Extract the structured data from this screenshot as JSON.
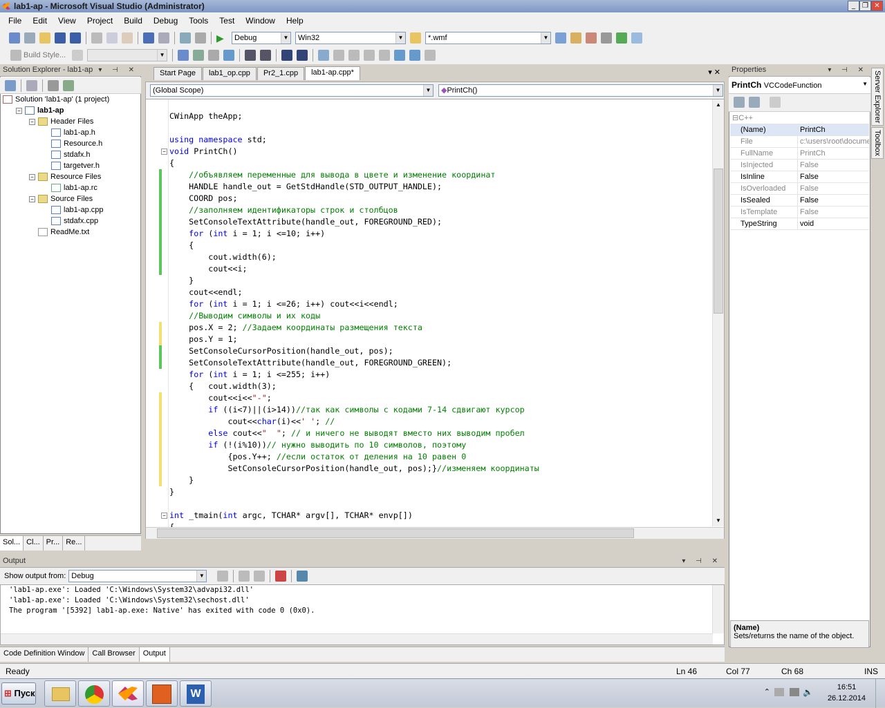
{
  "window": {
    "title": "lab1-ap - Microsoft Visual Studio (Administrator)",
    "minimize": "_",
    "maximize": "❐",
    "close": "✕"
  },
  "menu": [
    "File",
    "Edit",
    "View",
    "Project",
    "Build",
    "Debug",
    "Tools",
    "Test",
    "Window",
    "Help"
  ],
  "toolbar": {
    "config": "Debug",
    "platform": "Win32",
    "find": "*.wmf",
    "build_style": "Build Style..."
  },
  "solution_explorer": {
    "title": "Solution Explorer - lab1-ap",
    "tree": [
      {
        "label": "Solution 'lab1-ap' (1 project)",
        "level": 0,
        "kind": "solution"
      },
      {
        "label": "lab1-ap",
        "level": 1,
        "kind": "project",
        "bold": true
      },
      {
        "label": "Header Files",
        "level": 2,
        "kind": "folder"
      },
      {
        "label": "lab1-ap.h",
        "level": 3,
        "kind": "h"
      },
      {
        "label": "Resource.h",
        "level": 3,
        "kind": "h"
      },
      {
        "label": "stdafx.h",
        "level": 3,
        "kind": "h"
      },
      {
        "label": "targetver.h",
        "level": 3,
        "kind": "h"
      },
      {
        "label": "Resource Files",
        "level": 2,
        "kind": "folder"
      },
      {
        "label": "lab1-ap.rc",
        "level": 3,
        "kind": "rc"
      },
      {
        "label": "Source Files",
        "level": 2,
        "kind": "folder"
      },
      {
        "label": "lab1-ap.cpp",
        "level": 3,
        "kind": "cpp"
      },
      {
        "label": "stdafx.cpp",
        "level": 3,
        "kind": "cpp"
      },
      {
        "label": "ReadMe.txt",
        "level": 2,
        "kind": "txt"
      }
    ],
    "tabs": [
      "Sol...",
      "Cl...",
      "Pr...",
      "Re..."
    ]
  },
  "doc_tabs": [
    "Start Page",
    "lab1_op.cpp",
    "Pr2_1.cpp",
    "lab1-ap.cpp*"
  ],
  "scope": {
    "left": "(Global Scope)",
    "right": "PrintCh()"
  },
  "code_lines": [
    [
      {
        "t": "CWinApp theApp;",
        "c": ""
      }
    ],
    [
      {
        "t": "",
        "c": ""
      }
    ],
    [
      {
        "t": "using",
        "c": "kw"
      },
      {
        "t": " ",
        "c": ""
      },
      {
        "t": "namespace",
        "c": "kw"
      },
      {
        "t": " std;",
        "c": ""
      }
    ],
    [
      {
        "t": "void",
        "c": "kw"
      },
      {
        "t": " PrintCh()",
        "c": ""
      }
    ],
    [
      {
        "t": "{",
        "c": ""
      }
    ],
    [
      {
        "t": "    //объявляем переменные для вывода в цвете и изменение координат",
        "c": "cm"
      }
    ],
    [
      {
        "t": "    HANDLE handle_out = GetStdHandle(STD_OUTPUT_HANDLE);",
        "c": ""
      }
    ],
    [
      {
        "t": "    COORD pos;",
        "c": ""
      }
    ],
    [
      {
        "t": "    //заполняем идентификаторы строк и столбцов",
        "c": "cm"
      }
    ],
    [
      {
        "t": "    SetConsoleTextAttribute(handle_out, FOREGROUND_RED);",
        "c": ""
      }
    ],
    [
      {
        "t": "    ",
        "c": ""
      },
      {
        "t": "for",
        "c": "kw"
      },
      {
        "t": " (",
        "c": ""
      },
      {
        "t": "int",
        "c": "kw"
      },
      {
        "t": " i = 1; i <=10; i++)",
        "c": ""
      }
    ],
    [
      {
        "t": "    {",
        "c": ""
      }
    ],
    [
      {
        "t": "        cout.width(6);",
        "c": ""
      }
    ],
    [
      {
        "t": "        cout<<i;",
        "c": ""
      }
    ],
    [
      {
        "t": "    }",
        "c": ""
      }
    ],
    [
      {
        "t": "    cout<<endl;",
        "c": ""
      }
    ],
    [
      {
        "t": "    ",
        "c": ""
      },
      {
        "t": "for",
        "c": "kw"
      },
      {
        "t": " (",
        "c": ""
      },
      {
        "t": "int",
        "c": "kw"
      },
      {
        "t": " i = 1; i <=26; i++) cout<<i<<endl;",
        "c": ""
      }
    ],
    [
      {
        "t": "    //Выводим символы и их коды",
        "c": "cm"
      }
    ],
    [
      {
        "t": "    pos.X = 2; ",
        "c": ""
      },
      {
        "t": "//Задаем координаты размещения текста",
        "c": "cm"
      }
    ],
    [
      {
        "t": "    pos.Y = 1;",
        "c": ""
      }
    ],
    [
      {
        "t": "    SetConsoleCursorPosition(handle_out, pos);",
        "c": ""
      }
    ],
    [
      {
        "t": "    SetConsoleTextAttribute(handle_out, FOREGROUND_GREEN);",
        "c": ""
      }
    ],
    [
      {
        "t": "    ",
        "c": ""
      },
      {
        "t": "for",
        "c": "kw"
      },
      {
        "t": " (",
        "c": ""
      },
      {
        "t": "int",
        "c": "kw"
      },
      {
        "t": " i = 1; i <=255; i++)",
        "c": ""
      }
    ],
    [
      {
        "t": "    {   cout.width(3);",
        "c": ""
      }
    ],
    [
      {
        "t": "        cout<<i<<",
        "c": ""
      },
      {
        "t": "\"-\"",
        "c": "st"
      },
      {
        "t": ";",
        "c": ""
      }
    ],
    [
      {
        "t": "        ",
        "c": ""
      },
      {
        "t": "if",
        "c": "kw"
      },
      {
        "t": " ((i<7)||(i>14))",
        "c": ""
      },
      {
        "t": "//так как символы с кодами 7-14 сдвигают курсор",
        "c": "cm"
      }
    ],
    [
      {
        "t": "            cout<<",
        "c": ""
      },
      {
        "t": "char",
        "c": "kw"
      },
      {
        "t": "(i)<<",
        "c": ""
      },
      {
        "t": "' '",
        "c": "st"
      },
      {
        "t": "; ",
        "c": ""
      },
      {
        "t": "//",
        "c": "cm"
      }
    ],
    [
      {
        "t": "        ",
        "c": ""
      },
      {
        "t": "else",
        "c": "kw"
      },
      {
        "t": " cout<<",
        "c": ""
      },
      {
        "t": "\"  \"",
        "c": "st"
      },
      {
        "t": "; ",
        "c": ""
      },
      {
        "t": "// и ничего не выводят вместо них выводим пробел",
        "c": "cm"
      }
    ],
    [
      {
        "t": "        ",
        "c": ""
      },
      {
        "t": "if",
        "c": "kw"
      },
      {
        "t": " (!(i%10))",
        "c": ""
      },
      {
        "t": "// нужно выводить по 10 символов, поэтому",
        "c": "cm"
      }
    ],
    [
      {
        "t": "            {pos.Y++; ",
        "c": ""
      },
      {
        "t": "//если остаток от деления на 10 равен 0",
        "c": "cm"
      }
    ],
    [
      {
        "t": "            SetConsoleCursorPosition(handle_out, pos);}",
        "c": ""
      },
      {
        "t": "//изменяем координаты",
        "c": "cm"
      }
    ],
    [
      {
        "t": "    }",
        "c": ""
      }
    ],
    [
      {
        "t": "}",
        "c": ""
      }
    ],
    [
      {
        "t": "",
        "c": ""
      }
    ],
    [
      {
        "t": "int",
        "c": "kw"
      },
      {
        "t": " _tmain(",
        "c": ""
      },
      {
        "t": "int",
        "c": "kw"
      },
      {
        "t": " argc, TCHAR* argv[], TCHAR* envp[])",
        "c": ""
      }
    ],
    [
      {
        "t": "{",
        "c": ""
      }
    ]
  ],
  "output": {
    "title": "Output",
    "show_from_label": "Show output from:",
    "source": "Debug",
    "lines": [
      "'lab1-ap.exe': Loaded 'C:\\Windows\\System32\\advapi32.dll'",
      "'lab1-ap.exe': Loaded 'C:\\Windows\\System32\\sechost.dll'",
      "The program '[5392] lab1-ap.exe: Native' has exited with code 0 (0x0)."
    ],
    "tabs": [
      "Code Definition Window",
      "Call Browser",
      "Output"
    ]
  },
  "properties": {
    "title": "Properties",
    "object_name": "PrintCh",
    "object_type": "VCCodeFunction",
    "category": "C++",
    "rows": [
      {
        "name": "(Name)",
        "value": "PrintCh",
        "dim": false
      },
      {
        "name": "File",
        "value": "c:\\users\\root\\docume",
        "dim": true
      },
      {
        "name": "FullName",
        "value": "PrintCh",
        "dim": true
      },
      {
        "name": "IsInjected",
        "value": "False",
        "dim": true
      },
      {
        "name": "IsInline",
        "value": "False",
        "dim": false
      },
      {
        "name": "IsOverloaded",
        "value": "False",
        "dim": true
      },
      {
        "name": "IsSealed",
        "value": "False",
        "dim": false
      },
      {
        "name": "IsTemplate",
        "value": "False",
        "dim": true
      },
      {
        "name": "TypeString",
        "value": "void",
        "dim": false
      }
    ],
    "desc_title": "(Name)",
    "desc_text": "Sets/returns the name of the object."
  },
  "side_tabs": [
    "Server Explorer",
    "Toolbox"
  ],
  "status": {
    "ready": "Ready",
    "ln": "Ln 46",
    "col": "Col 77",
    "ch": "Ch 68",
    "ins": "INS"
  },
  "taskbar": {
    "start": "Пуск",
    "time": "16:51",
    "date": "26.12.2014"
  }
}
